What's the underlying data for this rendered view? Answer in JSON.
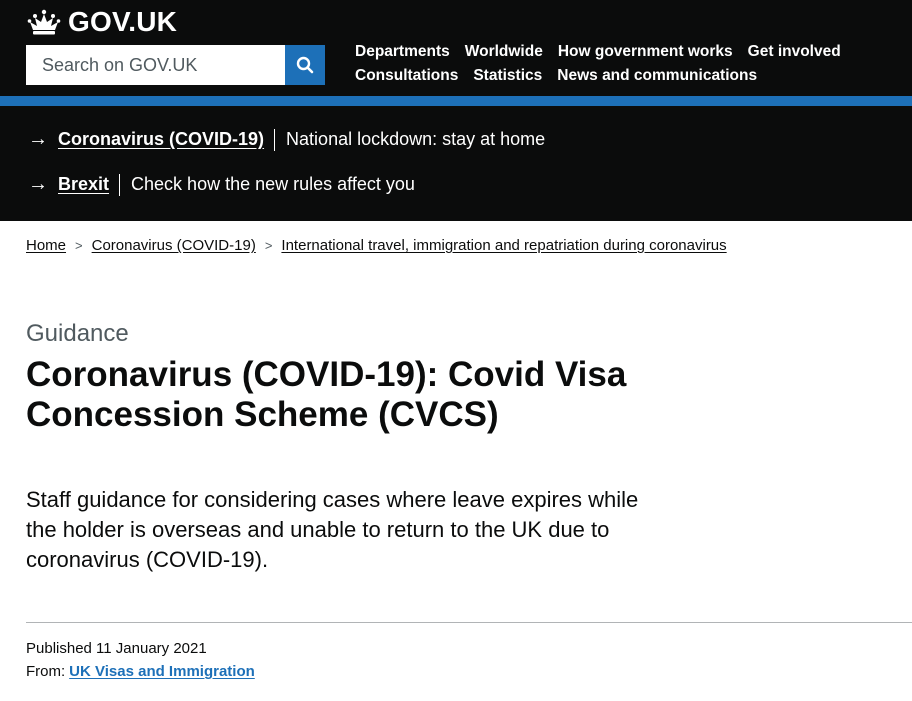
{
  "header": {
    "logo_text": "GOV.UK",
    "search_placeholder": "Search on GOV.UK",
    "nav_row1": [
      "Departments",
      "Worldwide",
      "How government works",
      "Get involved"
    ],
    "nav_row2": [
      "Consultations",
      "Statistics",
      "News and communications"
    ]
  },
  "banner": {
    "items": [
      {
        "link": "Coronavirus (COVID-19)",
        "text": "National lockdown: stay at home"
      },
      {
        "link": "Brexit",
        "text": "Check how the new rules affect you"
      }
    ]
  },
  "breadcrumb": [
    "Home",
    "Coronavirus (COVID-19)",
    "International travel, immigration and repatriation during coronavirus"
  ],
  "page": {
    "caption": "Guidance",
    "title": "Coronavirus (COVID-19): Covid Visa Concession Scheme (CVCS)",
    "lede": "Staff guidance for considering cases where leave expires while the holder is overseas and unable to return to the UK due to coronavirus (COVID-19).",
    "published": "Published 11 January 2021",
    "from_label": "From:",
    "from_link": "UK Visas and Immigration"
  },
  "colors": {
    "header_bg": "#0b0c0c",
    "brand_blue": "#1d70b8",
    "text": "#0b0c0c",
    "secondary_text": "#505a5f"
  }
}
